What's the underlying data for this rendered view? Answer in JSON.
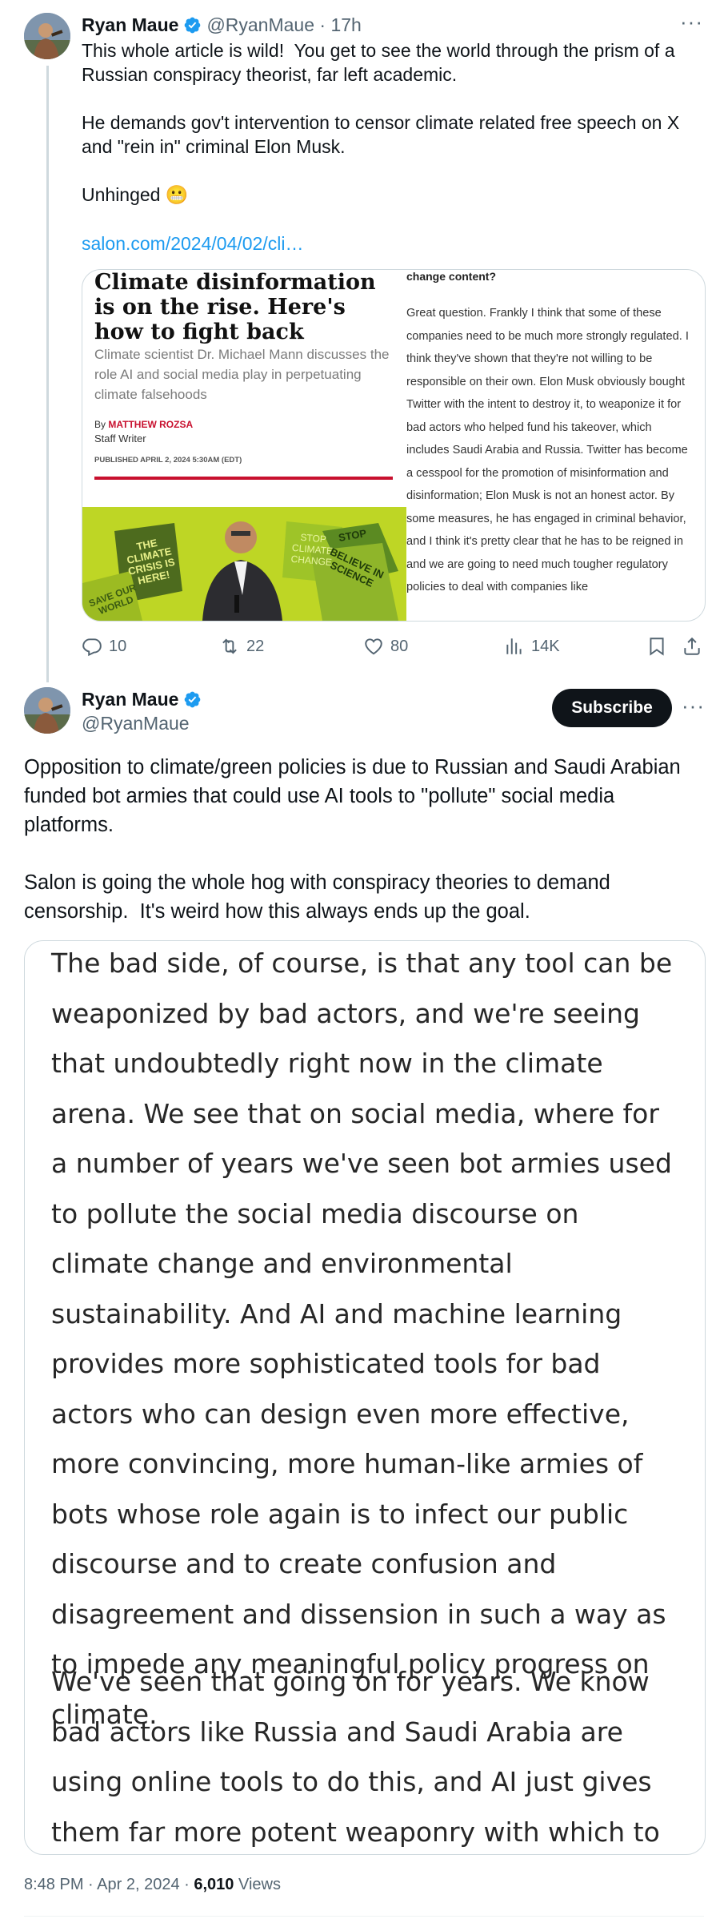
{
  "tweet1": {
    "author_name": "Ryan Maue",
    "handle_time": "@RyanMaue · 17h",
    "text": "This whole article is wild!  You get to see the world through the prism of a Russian conspiracy theorist, far left academic.\n\nHe demands gov't intervention to censor climate related free speech on X and \"rein in\" criminal Elon Musk.\n\nUnhinged 😬",
    "link": "salon.com/2024/04/02/cli…",
    "card": {
      "headline": "Climate disinformation is on the rise. Here's how to fight back",
      "dek": "Climate scientist Dr. Michael Mann discusses the role AI and social media play in perpetuating climate falsehoods",
      "byline_prefix": "By",
      "byline_author": "MATTHEW ROZSA",
      "byline_role": "Staff Writer",
      "published": "PUBLISHED APRIL 2, 2024 5:30AM (EDT)",
      "question_tail": "change content?",
      "answer": "Great question. Frankly I think that some of these companies need to be much more strongly regulated. I think they've shown that they're not willing to be responsible on their own. Elon Musk obviously bought Twitter with the intent to destroy it, to weaponize it for bad actors who helped fund his takeover, which includes Saudi Arabia and Russia. Twitter has become a cesspool for the promotion of misinformation and disinformation; Elon Musk is not an honest actor. By some measures, he has engaged in criminal behavior, and I think it's pretty clear that he has to be reigned in and we are going to need much tougher regulatory policies to deal with companies like",
      "photo_signs": [
        "THE CLIMATE CRISIS IS HERE!",
        "STOP CLIMATE CHANGE",
        "STOP",
        "BELIEVE IN SCIENCE",
        "SAVE OUR WORLD"
      ]
    },
    "actions": {
      "replies": "10",
      "reposts": "22",
      "likes": "80",
      "views": "14K"
    }
  },
  "tweet2": {
    "author_name": "Ryan Maue",
    "handle": "@RyanMaue",
    "subscribe_label": "Subscribe",
    "text": "Opposition to climate/green policies is due to Russian and Saudi Arabian funded bot armies that could use AI tools to \"pollute\" social media platforms.\n\nSalon is going the whole hog with conspiracy theories to demand censorship.  It's weird how this always ends up the goal.",
    "quote_paragraph_1": "The bad side, of course, is that any tool can be weaponized by bad actors, and we're seeing that undoubtedly right now in the climate arena. We see that on social media, where for a number of years we've seen bot armies used to pollute the social media discourse on climate change and environmental sustainability. And AI and machine learning provides more sophisticated tools for bad actors who can design even more effective, more convincing, more human-like armies of bots whose role again is to infect our public discourse and to create confusion and disagreement and dissension in such a way as to impede any meaningful policy progress on climate.",
    "quote_paragraph_2": "We've seen that going on for years. We know bad actors like Russia and Saudi Arabia are using online tools to do this, and AI just gives them far more potent weaponry with which to continue that",
    "timestamp": "8:48 PM · Apr 2, 2024 · ",
    "views_count": "6,010",
    "views_label": " Views"
  },
  "colors": {
    "accent": "#1d9bf0",
    "verified": "#1d9bf0",
    "text_primary": "#0f1419",
    "text_secondary": "#536471",
    "byline_red": "#c8102e",
    "photo_green": "#c6dc2c"
  },
  "icons": [
    "verified-badge-icon",
    "more-icon",
    "reply-icon",
    "repost-icon",
    "like-icon",
    "views-icon",
    "bookmark-icon",
    "share-icon"
  ]
}
